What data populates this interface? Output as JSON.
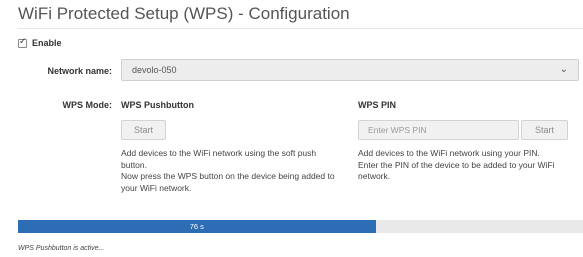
{
  "page": {
    "title": "WiFi Protected Setup (WPS) - Configuration"
  },
  "enable": {
    "label": "Enable",
    "checked": true
  },
  "network": {
    "label": "Network name:",
    "selected": "devolo-050",
    "icon": "chevron-down-icon"
  },
  "wps": {
    "mode_label": "WPS Mode:",
    "pushbutton": {
      "title": "WPS Pushbutton",
      "start_label": "Start",
      "desc_line1": "Add devices to the WiFi network using the soft push button.",
      "desc_line2": "Now press the WPS button on the device being added to your WiFi network."
    },
    "pin": {
      "title": "WPS PIN",
      "placeholder": "Enter WPS PIN",
      "start_label": "Start",
      "desc_line1": "Add devices to the WiFi network using your PIN.",
      "desc_line2": "Enter the PIN of the device to be added to your WiFi network."
    }
  },
  "progress": {
    "text": "76 s",
    "fraction": 0.633,
    "color": "#2d6db5"
  },
  "status": {
    "text": "WPS Pushbutton is active..."
  }
}
